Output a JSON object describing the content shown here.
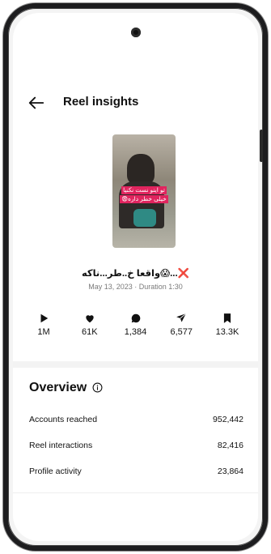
{
  "header": {
    "title": "Reel insights",
    "back_icon": "arrow-left-icon"
  },
  "reel": {
    "thumbnail_caption_line1": "تو اینو نست نکنیا",
    "thumbnail_caption_line2": "خیلی خطر داره😨",
    "caption_prefix": "❌",
    "caption_text": "واقعا خ..طر...ناکه😱...",
    "meta": "May 13, 2023 · Duration 1:30"
  },
  "stats": [
    {
      "icon": "play-icon",
      "value": "1M"
    },
    {
      "icon": "heart-icon",
      "value": "61K"
    },
    {
      "icon": "comment-icon",
      "value": "1,384"
    },
    {
      "icon": "share-icon",
      "value": "6,577"
    },
    {
      "icon": "bookmark-icon",
      "value": "13.3K"
    }
  ],
  "overview": {
    "title": "Overview",
    "rows": [
      {
        "label": "Accounts reached",
        "value": "952,442"
      },
      {
        "label": "Reel interactions",
        "value": "82,416"
      },
      {
        "label": "Profile activity",
        "value": "23,864"
      }
    ]
  },
  "colors": {
    "caption_highlight": "#e0245e",
    "text": "#111111",
    "muted": "#7a7a7a"
  }
}
